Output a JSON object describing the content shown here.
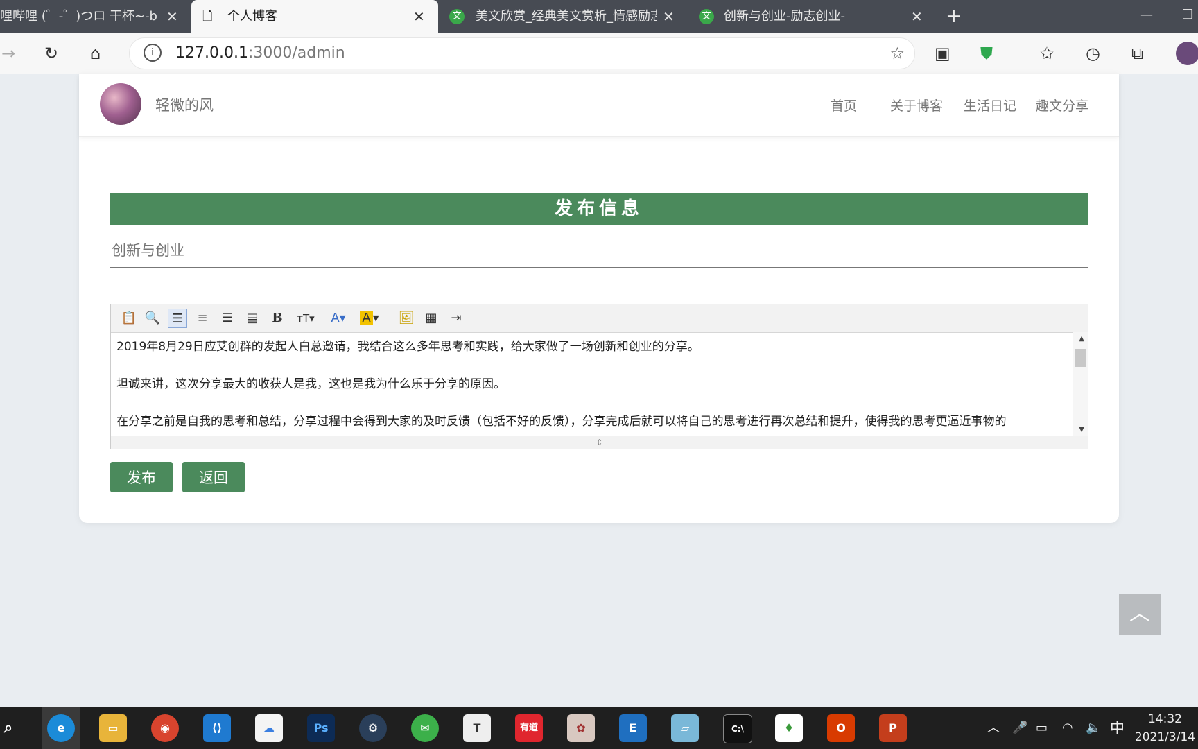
{
  "browser": {
    "tabs": [
      {
        "title": "哔哩哔哩 (゜-゜)つロ 干杯~-bilibili",
        "active": false
      },
      {
        "title": "个人博客",
        "active": true
      },
      {
        "title": "美文欣赏_经典美文赏析_情感励志",
        "active": false
      },
      {
        "title": "创新与创业-励志创业-",
        "active": false
      }
    ],
    "url_host": "127.0.0.1",
    "url_path": ":3000/admin"
  },
  "site": {
    "name": "轻微的风",
    "nav": [
      "首页",
      "关于博客",
      "生活日记",
      "趣文分享"
    ]
  },
  "form": {
    "banner": "发布信息",
    "title_placeholder": "创新与创业",
    "content": [
      "2019年8月29日应艾创群的发起人白总邀请，我结合这么多年思考和实践，给大家做了一场创新和创业的分享。",
      "坦诚来讲，这次分享最大的收获人是我，这也是我为什么乐于分享的原因。",
      "在分享之前是自我的思考和总结，分享过程中会得到大家的及时反馈（包括不好的反馈），分享完成后就可以将自己的思考进行再次总结和提升，使得我的思考更逼近事物的"
    ],
    "publish_label": "发布",
    "back_label": "返回"
  },
  "editor_toolbar": [
    "paste-icon",
    "preview-icon",
    "align-left-icon",
    "align-center-icon",
    "align-right-icon",
    "align-justify-icon",
    "bold-icon",
    "font-size-icon",
    "font-color-icon",
    "highlight-icon",
    "image-icon",
    "table-icon",
    "indent-icon"
  ],
  "taskbar": {
    "apps": [
      "search-icon",
      "edge-icon",
      "file-explorer-icon",
      "chrome-icon",
      "vscode-icon",
      "baidu-netdisk-icon",
      "photoshop-icon",
      "steam-icon",
      "wechat-icon",
      "typora-icon",
      "youdao-icon",
      "app-icon",
      "editor-icon",
      "notepad-icon",
      "terminal-icon",
      "mongodb-icon",
      "office-icon",
      "powerpoint-icon"
    ],
    "ime": "中",
    "time": "14:32",
    "date": "2021/3/14"
  },
  "colors": {
    "accent_green": "#4b8a5c",
    "tab_bar": "#474b53"
  }
}
